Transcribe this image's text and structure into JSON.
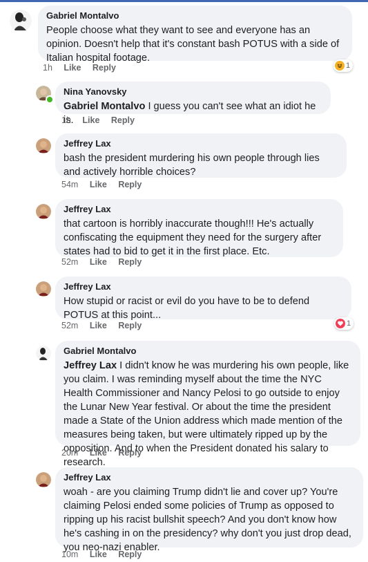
{
  "comments": [
    {
      "author": "Gabriel Montalvo",
      "mention": "",
      "text": "People choose what they want to see and everyone has an opinion. Doesn't help that it's constant bash POTUS with a side of Italian hospital footage.",
      "time": "1h",
      "like": "Like",
      "reply": "Reply",
      "reaction": {
        "icon": "haha-icon",
        "count": "1",
        "color": "#f7b125"
      }
    },
    {
      "author": "Nina Yanovsky",
      "mention": "Gabriel Montalvo",
      "text": "I guess you can't see what an idiot he is.",
      "time": "1h",
      "like": "Like",
      "reply": "Reply"
    },
    {
      "author": "Jeffrey Lax",
      "mention": "",
      "text": "bash the president murdering his own people through lies and actively horrible choices?",
      "time": "54m",
      "like": "Like",
      "reply": "Reply"
    },
    {
      "author": "Jeffrey Lax",
      "mention": "",
      "text": "that cartoon is horribly inaccurate though!!! He's actually confiscating the equipment they need for the surgery after states had to bid to get it in the first place.  Etc.",
      "time": "52m",
      "like": "Like",
      "reply": "Reply"
    },
    {
      "author": "Jeffrey Lax",
      "mention": "",
      "text": "How stupid or racist or evil do you have to be to defend POTUS at this point...",
      "time": "52m",
      "like": "Like",
      "reply": "Reply",
      "reaction": {
        "icon": "love-icon",
        "count": "1",
        "color": "#f33e58"
      }
    },
    {
      "author": "Gabriel Montalvo",
      "mention": "Jeffrey Lax",
      "text": "I didn't know he was murdering his own people, like you claim. I was reminding myself about the time the NYC Health Commissioner and Nancy Pelosi to go outside to enjoy the Lunar New Year festival. Or about the time the president made a State of the Union address which made mention of the measures being taken, but were ultimately ripped up by the opposition. And to when the President donated his salary to research.",
      "time": "20m",
      "like": "Like",
      "reply": "Reply"
    },
    {
      "author": "Jeffrey Lax",
      "mention": "",
      "text": "woah - are you claiming Trump didn't lie and cover up?  You're claiming Pelosi ended some policies of Trump as opposed to ripping up his racist bullshit speech?  And you don't know how he's cashing in on the presidency?  why don't you just drop dead, you neo-nazi enabler.",
      "time": "10m",
      "like": "Like",
      "reply": "Reply"
    }
  ]
}
